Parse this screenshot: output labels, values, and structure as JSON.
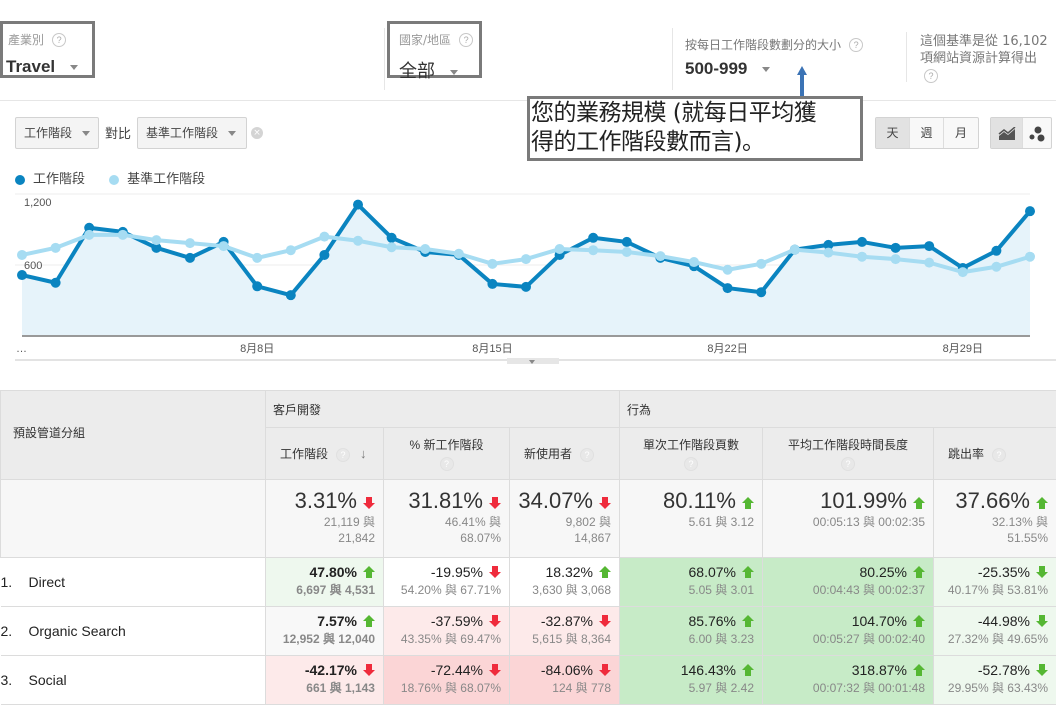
{
  "filters": {
    "industry": {
      "label": "產業別",
      "value": "Travel"
    },
    "country": {
      "label": "國家/地區",
      "value": "全部"
    },
    "size": {
      "label": "按每日工作階段數劃分的大小",
      "value": "500-999"
    },
    "benchmark_note": {
      "line1": "這個基準是從 16,102",
      "line2": "項網站資源計算得出"
    }
  },
  "callout": {
    "line1": "您的業務規模 (就每日平均獲",
    "line2": "得的工作階段數而言)。"
  },
  "controls": {
    "metric_dropdown": "工作階段",
    "vs_label": "對比",
    "compare_dropdown": "基準工作階段",
    "granularity": [
      {
        "label": "天",
        "active": true
      },
      {
        "label": "週",
        "active": false
      },
      {
        "label": "月",
        "active": false
      }
    ],
    "chart_type_icons": [
      "line-chart-icon",
      "motion-chart-icon"
    ]
  },
  "colors": {
    "sessions": "#0a84c0",
    "benchmark": "#a6dcf2",
    "area_fill": "#e6f3fa",
    "positive_strong": "#c7ebc7",
    "positive_light": "#eef8ee",
    "negative_light": "#fdeaea",
    "negative_strong": "#fbd5d6",
    "arrow_up_green": "#55b733",
    "arrow_down_red": "#ef2b3c",
    "arrow_down_green": "#55b733"
  },
  "chart_data": {
    "type": "line",
    "title": "",
    "xlabel": "",
    "ylabel": "",
    "ylim": [
      0,
      1200
    ],
    "yticks": [
      "600",
      "1,200"
    ],
    "ytick_values": [
      600,
      1200
    ],
    "xtick_labels": [
      "…",
      "8月8日",
      "8月15日",
      "8月22日",
      "8月29日"
    ],
    "xtick_index": [
      0,
      7,
      14,
      21,
      28
    ],
    "x": [
      "8/1",
      "8/2",
      "8/3",
      "8/4",
      "8/5",
      "8/6",
      "8/7",
      "8/8",
      "8/9",
      "8/10",
      "8/11",
      "8/12",
      "8/13",
      "8/14",
      "8/15",
      "8/16",
      "8/17",
      "8/18",
      "8/19",
      "8/20",
      "8/21",
      "8/22",
      "8/23",
      "8/24",
      "8/25",
      "8/26",
      "8/27",
      "8/28",
      "8/29",
      "8/30",
      "8/31"
    ],
    "legend": [
      "工作階段",
      "基準工作階段"
    ],
    "legend_position": "top-left",
    "grid": true,
    "series": [
      {
        "name": "工作階段",
        "filled": true,
        "values": [
          515,
          450,
          915,
          880,
          745,
          660,
          795,
          420,
          345,
          685,
          1110,
          830,
          710,
          685,
          440,
          415,
          685,
          830,
          795,
          660,
          590,
          405,
          370,
          730,
          770,
          795,
          745,
          760,
          575,
          720,
          1055
        ]
      },
      {
        "name": "基準工作階段",
        "filled": false,
        "values": [
          685,
          745,
          855,
          855,
          810,
          785,
          760,
          660,
          725,
          840,
          805,
          750,
          735,
          695,
          610,
          650,
          735,
          725,
          710,
          675,
          625,
          560,
          610,
          730,
          705,
          670,
          650,
          620,
          540,
          585,
          670
        ]
      }
    ]
  },
  "table": {
    "dimension_header": "預設管道分組",
    "group_headers": [
      "客戶開發",
      "行為"
    ],
    "columns": [
      {
        "label": "工作階段",
        "help": true,
        "sorted": "desc"
      },
      {
        "label": "% 新工作階段",
        "help": true
      },
      {
        "label": "新使用者",
        "help": true
      },
      {
        "label": "單次工作階段頁數",
        "help": true
      },
      {
        "label": "平均工作階段時間長度",
        "help": true
      },
      {
        "label": "跳出率",
        "help": true
      }
    ],
    "summary": [
      {
        "value": "3.31%",
        "dir": "down",
        "tone": "bad",
        "sub1": "21,119 與",
        "sub2": "21,842"
      },
      {
        "value": "31.81%",
        "dir": "down",
        "tone": "bad",
        "sub1": "46.41% 與",
        "sub2": "68.07%"
      },
      {
        "value": "34.07%",
        "dir": "down",
        "tone": "bad",
        "sub1": "9,802 與",
        "sub2": "14,867"
      },
      {
        "value": "80.11%",
        "dir": "up",
        "tone": "good",
        "sub1": "5.61 與 3.12",
        "sub2": ""
      },
      {
        "value": "101.99%",
        "dir": "up",
        "tone": "good",
        "sub1": "00:05:13 與 00:02:35",
        "sub2": ""
      },
      {
        "value": "37.66%",
        "dir": "up",
        "tone": "good",
        "sub1": "32.13% 與",
        "sub2": "51.55%"
      }
    ],
    "rows": [
      {
        "index": "1.",
        "name": "Direct",
        "cells": [
          {
            "value": "47.80%",
            "dir": "up",
            "tone": "good",
            "sub": "6,697 與 4,531",
            "bg": "positive_light",
            "bold": true
          },
          {
            "value": "-19.95%",
            "dir": "down",
            "tone": "bad",
            "sub": "54.20% 與 67.71%",
            "bg": "white"
          },
          {
            "value": "18.32%",
            "dir": "up",
            "tone": "good",
            "sub": "3,630 與 3,068",
            "bg": "white"
          },
          {
            "value": "68.07%",
            "dir": "up",
            "tone": "good",
            "sub": "5.05 與 3.01",
            "bg": "positive_strong"
          },
          {
            "value": "80.25%",
            "dir": "up",
            "tone": "good",
            "sub": "00:04:43 與 00:02:37",
            "bg": "positive_strong"
          },
          {
            "value": "-25.35%",
            "dir": "down",
            "tone": "good",
            "sub": "40.17% 與 53.81%",
            "bg": "positive_light"
          }
        ]
      },
      {
        "index": "2.",
        "name": "Organic Search",
        "cells": [
          {
            "value": "7.57%",
            "dir": "up",
            "tone": "good",
            "sub": "12,952 與 12,040",
            "bg": "neutral",
            "bold": true
          },
          {
            "value": "-37.59%",
            "dir": "down",
            "tone": "bad",
            "sub": "43.35% 與 69.47%",
            "bg": "negative_light"
          },
          {
            "value": "-32.87%",
            "dir": "down",
            "tone": "bad",
            "sub": "5,615 與 8,364",
            "bg": "negative_light"
          },
          {
            "value": "85.76%",
            "dir": "up",
            "tone": "good",
            "sub": "6.00 與 3.23",
            "bg": "positive_strong"
          },
          {
            "value": "104.70%",
            "dir": "up",
            "tone": "good",
            "sub": "00:05:27 與 00:02:40",
            "bg": "positive_strong"
          },
          {
            "value": "-44.98%",
            "dir": "down",
            "tone": "good",
            "sub": "27.32% 與 49.65%",
            "bg": "positive_light"
          }
        ]
      },
      {
        "index": "3.",
        "name": "Social",
        "cells": [
          {
            "value": "-42.17%",
            "dir": "down",
            "tone": "bad",
            "sub": "661 與 1,143",
            "bg": "negative_light",
            "bold": true
          },
          {
            "value": "-72.44%",
            "dir": "down",
            "tone": "bad",
            "sub": "18.76% 與 68.07%",
            "bg": "negative_strong"
          },
          {
            "value": "-84.06%",
            "dir": "down",
            "tone": "bad",
            "sub": "124 與 778",
            "bg": "negative_strong"
          },
          {
            "value": "146.43%",
            "dir": "up",
            "tone": "good",
            "sub": "5.97 與 2.42",
            "bg": "positive_strong"
          },
          {
            "value": "318.87%",
            "dir": "up",
            "tone": "good",
            "sub": "00:07:32 與 00:01:48",
            "bg": "positive_strong"
          },
          {
            "value": "-52.78%",
            "dir": "down",
            "tone": "good",
            "sub": "29.95% 與 63.43%",
            "bg": "positive_light"
          }
        ]
      }
    ]
  }
}
